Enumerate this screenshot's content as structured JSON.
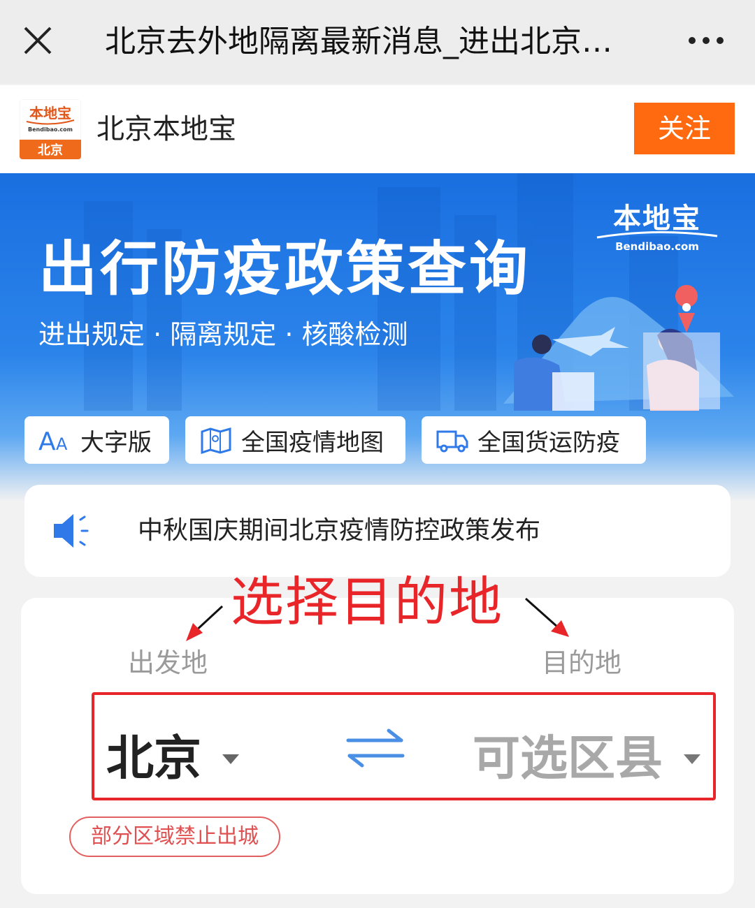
{
  "navbar": {
    "title": "北京去外地隔离最新消息_进出北京…",
    "close_icon": "close-icon",
    "more_icon": "more-dots-icon"
  },
  "account": {
    "logo_text_top": "本地宝",
    "logo_text_domain": "Bendibao.com",
    "logo_text_city": "北京",
    "name": "北京本地宝",
    "follow_label": "关注"
  },
  "banner": {
    "title": "出行防疫政策查询",
    "subtitle": "进出规定 · 隔离规定 · 核酸检测",
    "brand_cn": "本地宝",
    "brand_en": "Bendibao.com",
    "chips": [
      {
        "label": "大字版",
        "icon": "font-size-icon"
      },
      {
        "label": "全国疫情地图",
        "icon": "map-icon"
      },
      {
        "label": "全国货运防疫",
        "icon": "truck-icon"
      }
    ]
  },
  "notice": {
    "icon": "speaker-icon",
    "text": "中秋国庆期间北京疫情防控政策发布"
  },
  "query": {
    "annotation": "选择目的地",
    "from_label": "出发地",
    "to_label": "目的地",
    "from_value": "北京",
    "to_placeholder": "可选区县",
    "swap_icon": "swap-arrows-icon",
    "warning_badge": "部分区域禁止出城"
  },
  "colors": {
    "accent_orange": "#ff6a10",
    "banner_blue": "#1a6fe0",
    "annotation_red": "#e8262a"
  }
}
